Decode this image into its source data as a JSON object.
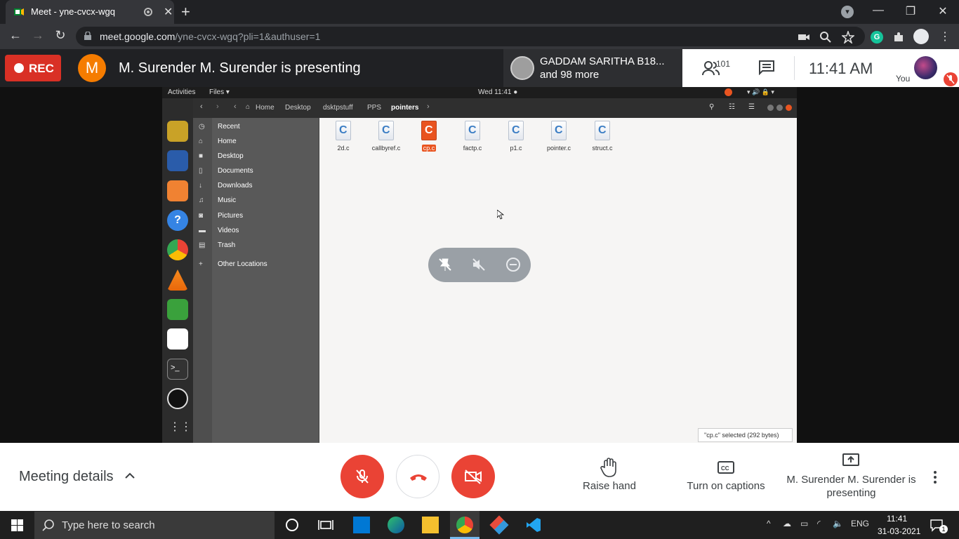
{
  "browser": {
    "tab_title": "Meet - yne-cvcx-wgq",
    "url_host": "meet.google.com",
    "url_path": "/yne-cvcx-wgq?pli=1&authuser=1"
  },
  "meet": {
    "rec_label": "REC",
    "presenter_initial": "M",
    "presenting_text": "M. Surender M. Surender is presenting",
    "participant_card": {
      "name": "GADDAM SARITHA B18...",
      "more": "and 98 more"
    },
    "people_count": "101",
    "time": "11:41  AM",
    "you_label": "You",
    "meeting_details": "Meeting details",
    "raise_hand": "Raise hand",
    "captions": "Turn on captions",
    "presenting_button": "M. Surender M. Surender is presenting"
  },
  "shared_screen": {
    "activities": "Activities",
    "files_menu": "Files ▾",
    "datetime": "Wed 11:41 ●",
    "breadcrumbs": [
      "Home",
      "Desktop",
      "dsktpstuff",
      "PPS",
      "pointers"
    ],
    "sidebar": [
      "Recent",
      "Home",
      "Desktop",
      "Documents",
      "Downloads",
      "Music",
      "Pictures",
      "Videos",
      "Trash",
      "Other Locations"
    ],
    "files": [
      "2d.c",
      "callbyref.c",
      "cp.c",
      "factp.c",
      "p1.c",
      "pointer.c",
      "struct.c"
    ],
    "selected_file": "cp.c",
    "status": "\"cp.c\" selected  (292 bytes)"
  },
  "taskbar": {
    "search_placeholder": "Type here to search",
    "language": "ENG",
    "time": "11:41",
    "date": "31-03-2021",
    "notifications": "1"
  },
  "colors": {
    "rec_red": "#d93025",
    "meet_red": "#ea4335",
    "ubuntu_orange": "#e95420",
    "avatar_orange": "#f57c00"
  }
}
